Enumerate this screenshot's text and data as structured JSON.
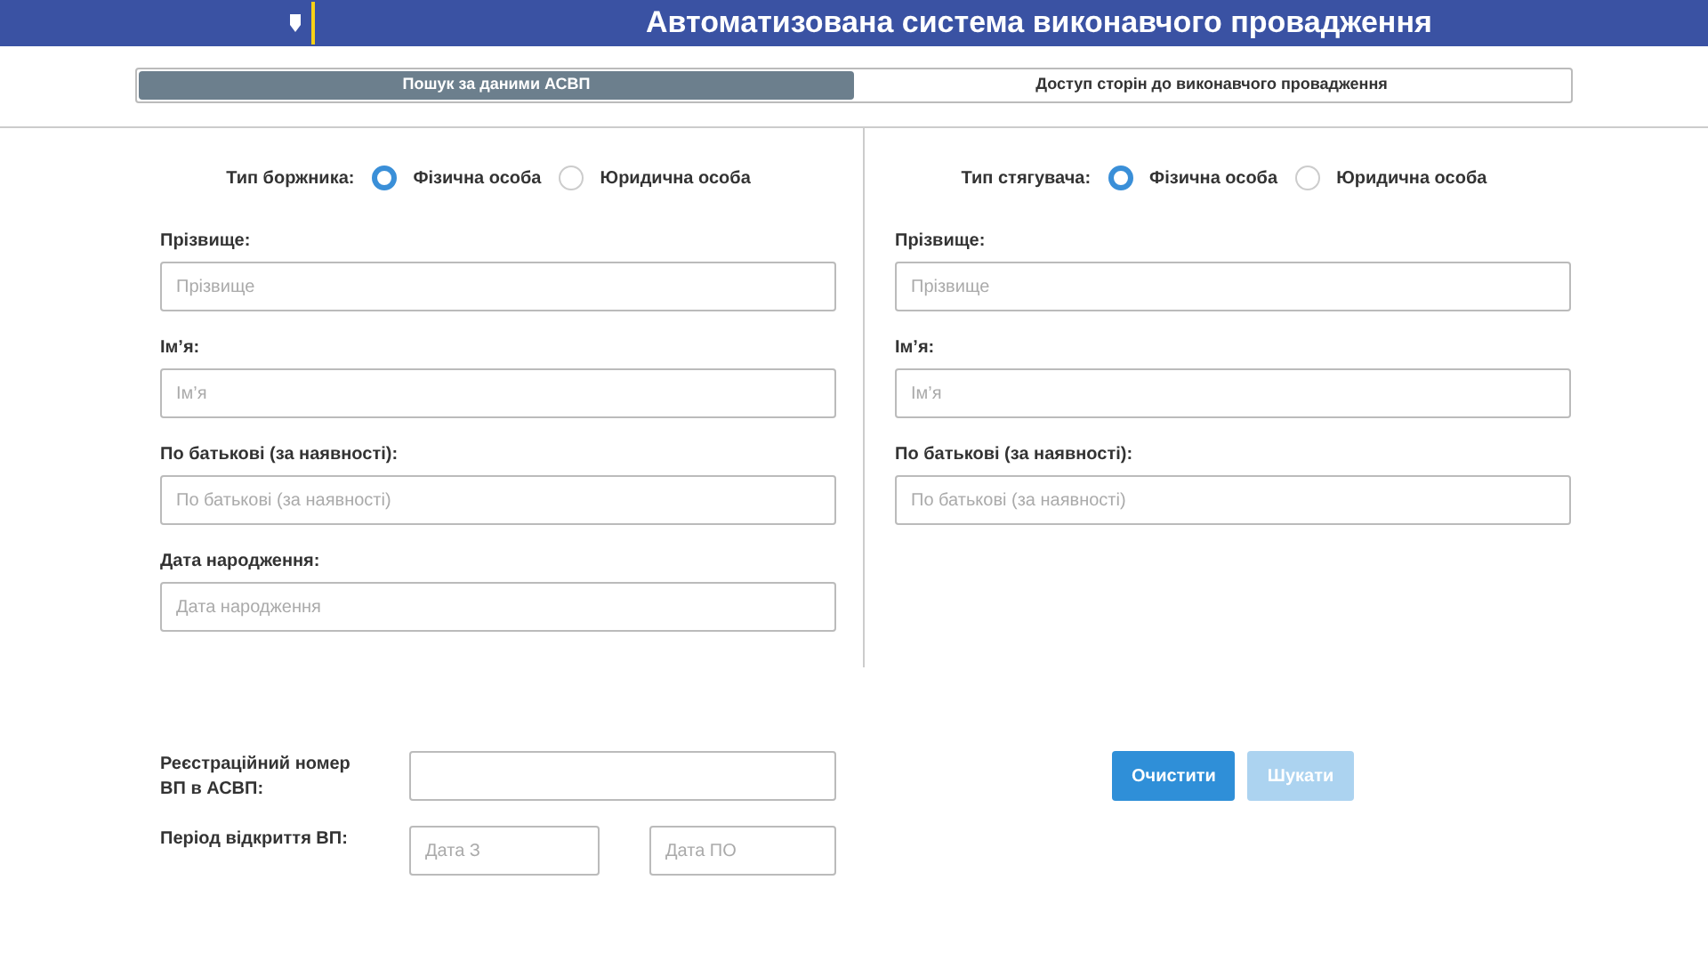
{
  "header": {
    "title": "Автоматизована система виконавчого провадження"
  },
  "tabs": [
    {
      "label": "Пошук за даними АСВП",
      "selected": true
    },
    {
      "label": "Доступ сторін до виконавчого провадження",
      "selected": false
    }
  ],
  "panels": [
    {
      "type_label": "Тип боржника:",
      "options": [
        {
          "label": "Фізична особа",
          "selected": true
        },
        {
          "label": "Юридична особа",
          "selected": false
        }
      ],
      "fields": [
        {
          "label": "Прізвище:",
          "placeholder": "Прізвище"
        },
        {
          "label": "Ім’я:",
          "placeholder": "Ім’я"
        },
        {
          "label": "По батькові (за наявності):",
          "placeholder": "По батькові (за наявності)"
        },
        {
          "label": "Дата народження:",
          "placeholder": "Дата народження"
        }
      ]
    },
    {
      "type_label": "Тип стягувача:",
      "options": [
        {
          "label": "Фізична особа",
          "selected": true
        },
        {
          "label": "Юридична особа",
          "selected": false
        }
      ],
      "fields": [
        {
          "label": "Прізвище:",
          "placeholder": "Прізвище"
        },
        {
          "label": "Ім’я:",
          "placeholder": "Ім’я"
        },
        {
          "label": "По батькові (за наявності):",
          "placeholder": "По батькові (за наявності)"
        }
      ]
    }
  ],
  "registration": {
    "label": "Реєстраційний номер ВП в АСВП:"
  },
  "period": {
    "label": "Період відкриття ВП:",
    "from_placeholder": "Дата З",
    "to_placeholder": "Дата ПО"
  },
  "buttons": [
    {
      "label": "Очистити",
      "disabled": false
    },
    {
      "label": "Шукати",
      "disabled": true
    }
  ]
}
